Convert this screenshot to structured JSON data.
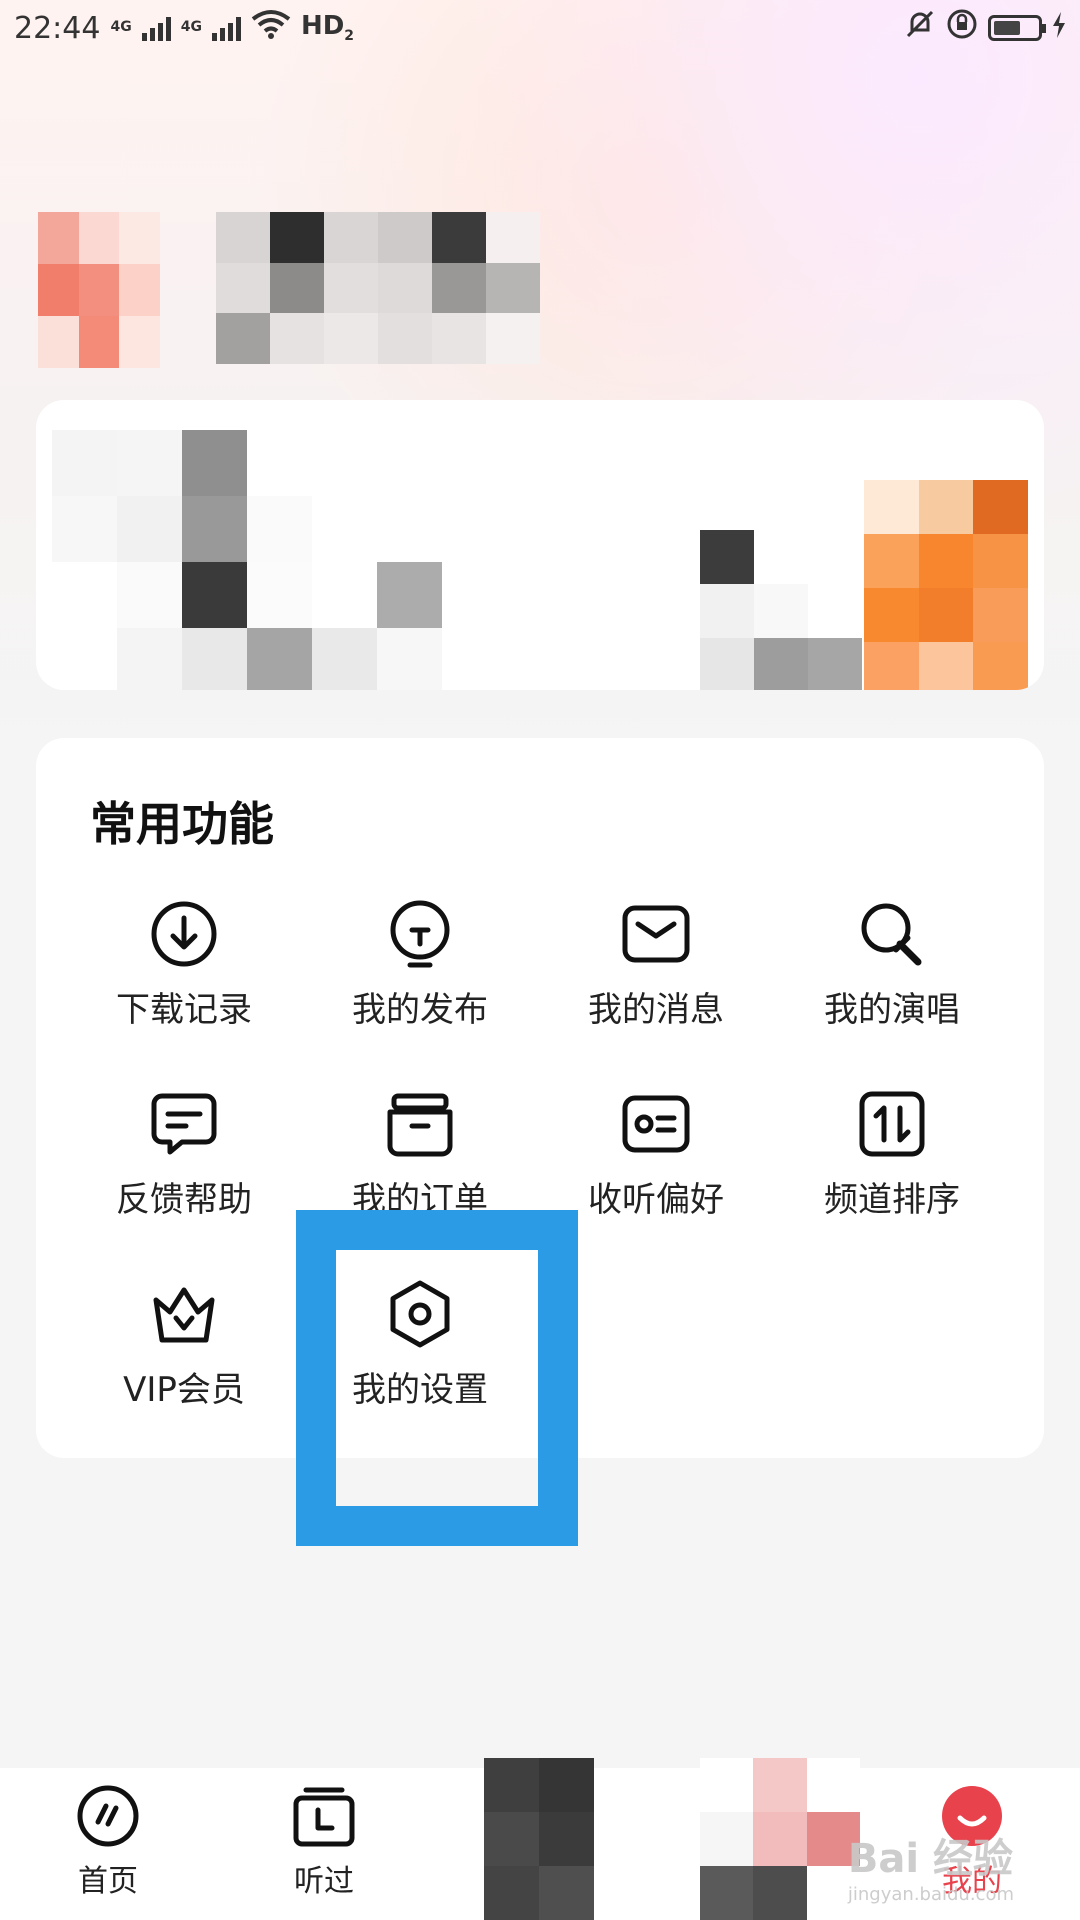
{
  "status_bar": {
    "time": "22:44",
    "network_1": "4G",
    "network_2": "4G",
    "hd_label": "HD",
    "hd_sub": "2"
  },
  "functions": {
    "title": "常用功能",
    "items": [
      {
        "label": "下载记录",
        "icon": "download-icon"
      },
      {
        "label": "我的发布",
        "icon": "publish-icon"
      },
      {
        "label": "我的消息",
        "icon": "message-icon"
      },
      {
        "label": "我的演唱",
        "icon": "microphone-icon"
      },
      {
        "label": "反馈帮助",
        "icon": "feedback-icon"
      },
      {
        "label": "我的订单",
        "icon": "order-box-icon"
      },
      {
        "label": "收听偏好",
        "icon": "preference-card-icon"
      },
      {
        "label": "频道排序",
        "icon": "sort-icon"
      },
      {
        "label": "VIP会员",
        "icon": "crown-icon"
      },
      {
        "label": "我的设置",
        "icon": "settings-hexagon-icon"
      }
    ]
  },
  "tabbar": {
    "tabs": [
      {
        "label": "首页",
        "icon": "home-icon"
      },
      {
        "label": "听过",
        "icon": "history-icon"
      },
      {
        "label": "我的",
        "icon": "profile-smile-icon",
        "active": true
      }
    ]
  },
  "watermark": {
    "text": "Bai 经验",
    "sub": "jingyan.baidu.com"
  },
  "colors": {
    "highlight": "#2b9be6",
    "active_tab": "#e8424c"
  }
}
